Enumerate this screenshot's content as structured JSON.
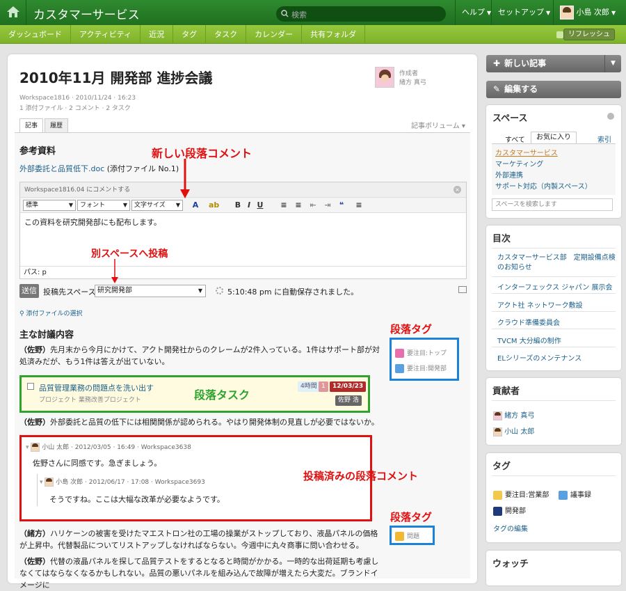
{
  "header": {
    "app_title": "カスタマーサービス",
    "search_placeholder": "検索",
    "help": "ヘルプ",
    "setup": "セットアップ",
    "user": "小島 次郎"
  },
  "subnav": {
    "items": [
      "ダッシュボード",
      "アクティビティ",
      "近況",
      "タグ",
      "タスク",
      "カレンダー",
      "共有フォルダ"
    ],
    "refresh": "リフレッシュ"
  },
  "article": {
    "title": "2010年11月 開発部 進捗会議",
    "meta1": "Workspace1816 · 2010/11/24 · 16:23",
    "meta2": "1 添付ファイル · 2 コメント · 2 タスク",
    "author_label": "作成者",
    "author_name": "緒方 真弓",
    "tabs": [
      "記事",
      "履歴"
    ],
    "volume": "記事ボリューム",
    "section1": "参考資料",
    "attachment_link": "外部委託と品質低下.doc",
    "attachment_note": "(添付ファイル No.1)",
    "section2": "主な討議内容"
  },
  "editor": {
    "header": "Workspace1816.04 にコメントする",
    "format": "標準",
    "font": "フォント",
    "size": "文字サイズ",
    "body": "この資料を研究開発部にも配布します。",
    "path": "パス: p",
    "send": "送信",
    "dest_label": "投稿先スペース",
    "dest_value": "研究開発部",
    "autosave": "5:10:48 pm に自動保存されました。",
    "attach_select": "添付ファイルの選択"
  },
  "paragraphs": {
    "p1_speaker": "（佐野）",
    "p1_text": "先月末から今月にかけて、アクト開発社からのクレームが2件入っている。1件はサポート部が対処済みだが、もう1件は答えが出ていない。",
    "p2_speaker": "（佐野）",
    "p2_text": "外部委託と品質の低下には相関関係が認められる。やはり開発体制の見直しが必要ではないか。",
    "p3_speaker": "（緒方）",
    "p3_text": "ハリケーンの被害を受けたマエストロン社の工場の操業がストップしており、液晶パネルの価格が上昇中。代替製品についてリストアップしなければならない。今週中に丸々商事に問い合わせる。",
    "p4_speaker": "（佐野）",
    "p4_text": "代替の液晶パネルを探して品質テストをするとなると時間がかかる。一時的な出荷延期も考慮しなくてはならなくなるかもしれない。品質の悪いパネルを組み込んで故障が増えたら大変だ。ブランドイメージに"
  },
  "task": {
    "title": "品質管理業務の問題点を洗い出す",
    "project": "プロジェクト 業務改善プロジェクト",
    "period": "4時間",
    "count": "1",
    "date": "12/03/23",
    "assignee": "佐野 浩"
  },
  "comments": [
    {
      "author": "小山 太郎",
      "meta": "· 2012/03/05 · 16:49 · Workspace3638",
      "text": "佐野さんに同感です。急ぎましょう。"
    },
    {
      "author": "小島 次郎",
      "meta": "· 2012/06/17 · 17:08 · Workspace3693",
      "text": "そうですね。ここは大幅な改革が必要なようです。"
    }
  ],
  "annotations": {
    "new_comment": "新しい段落コメント",
    "other_space": "別スペースへ投稿",
    "para_tag1": "段落タグ",
    "para_task": "段落タスク",
    "posted_comment": "投稿済みの段落コメント",
    "para_tag2": "段落タグ"
  },
  "para_tags": {
    "tag1": "要注目:トップ",
    "tag2": "要注目:開発部",
    "tag3": "問題"
  },
  "sidebar": {
    "new_article": "新しい記事",
    "edit": "編集する",
    "spaces_title": "スペース",
    "space_tabs": [
      "すべて",
      "お気に入り",
      "索引"
    ],
    "spaces": [
      "カスタマーサービス",
      "マーケティング",
      "外部連携",
      "サポート対応（内製スペース）"
    ],
    "space_search_placeholder": "スペースを検索します",
    "toc_title": "目次",
    "toc": [
      "カスタマーサービス部　定期設備点検のお知らせ",
      "インターフェックス ジャパン 展示会",
      "アクト社 ネットワーク敷設",
      "クラウド準備委員会",
      "TVCM 大分編の制作",
      "ELシリーズのメンテナンス"
    ],
    "contrib_title": "貢献者",
    "contributors": [
      "緒方 真弓",
      "小山 太郎"
    ],
    "tags_title": "タグ",
    "tags": [
      "要注目:営業部",
      "議事録",
      "開発部"
    ],
    "tag_edit": "タグの編集",
    "watch_title": "ウォッチ"
  }
}
